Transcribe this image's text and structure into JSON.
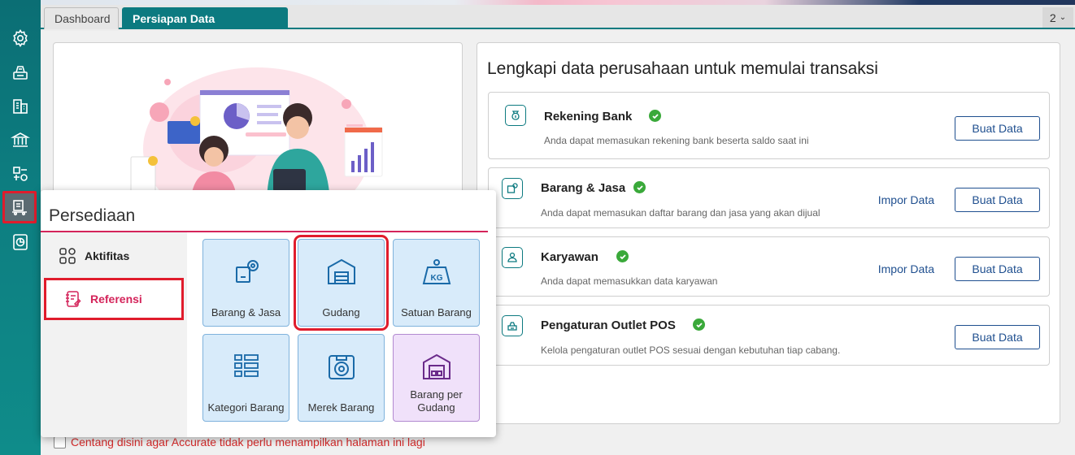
{
  "tabs": [
    {
      "label": "Dashboard",
      "active": false
    },
    {
      "label": "Persiapan Data Perusahaan",
      "active": true
    }
  ],
  "tab_count": "2",
  "sidebar_icons": [
    "settings-icon",
    "cash-register-icon",
    "building-icon",
    "bank-icon",
    "production-icon",
    "inventory-icon",
    "report-icon"
  ],
  "setup": {
    "title": "Lengkapi data perusahaan untuk memulai transaksi",
    "cards": [
      {
        "title": "Rekening Bank",
        "desc": "Anda dapat memasukan rekening bank beserta saldo saat ini",
        "has_import": false,
        "button": "Buat Data"
      },
      {
        "title": "Barang & Jasa",
        "desc": "Anda dapat memasukan daftar barang dan jasa yang akan dijual",
        "has_import": true,
        "import": "Impor Data",
        "button": "Buat Data"
      },
      {
        "title": "Karyawan",
        "desc": "Anda dapat memasukkan data karyawan",
        "has_import": true,
        "import": "Impor Data",
        "button": "Buat Data"
      },
      {
        "title": "Pengaturan Outlet POS",
        "desc": "Kelola pengaturan outlet POS sesuai dengan kebutuhan tiap cabang.",
        "has_import": false,
        "button": "Buat Data"
      }
    ]
  },
  "popup": {
    "title": "Persediaan",
    "left_items": [
      {
        "label": "Aktifitas",
        "selected": false
      },
      {
        "label": "Referensi",
        "selected": true
      }
    ],
    "tiles": [
      {
        "label": "Barang & Jasa"
      },
      {
        "label": "Gudang"
      },
      {
        "label": "Satuan Barang"
      },
      {
        "label": "Kategori Barang"
      },
      {
        "label": "Merek Barang"
      },
      {
        "label": "Barang per Gudang"
      }
    ]
  },
  "bottom_checkbox": "Centang disini agar Accurate tidak perlu menampilkan halaman ini lagi",
  "colors": {
    "teal": "#0c7a80",
    "accent_red": "#e01c2c",
    "pink": "#d4245a",
    "link_blue": "#1f4f8f",
    "check_green": "#3aa93a"
  }
}
